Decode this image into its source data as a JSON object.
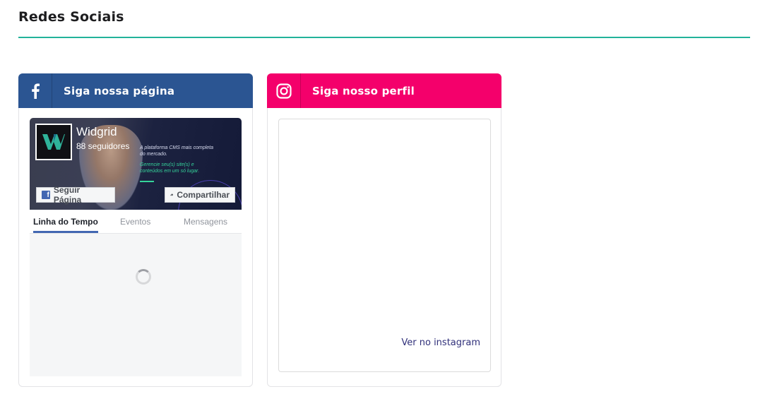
{
  "section": {
    "title": "Redes Sociais"
  },
  "facebook_card": {
    "header_label": "Siga nossa página",
    "icon": "facebook-icon",
    "color": "#2b5592",
    "embed": {
      "page_name": "Widgrid",
      "followers": "88 seguidores",
      "cover_text_primary": "A plataforma CMS mais completa do mercado.",
      "cover_text_secondary": "Gerencie seu(s) site(s) e conteúdos em um só lugar.",
      "follow_button": "Seguir Página",
      "share_button": "Compartilhar",
      "tabs": [
        {
          "label": "Linha do Tempo",
          "active": true
        },
        {
          "label": "Eventos",
          "active": false
        },
        {
          "label": "Mensagens",
          "active": false
        }
      ]
    }
  },
  "instagram_card": {
    "header_label": "Siga nosso perfil",
    "icon": "instagram-icon",
    "color": "#f4006b",
    "embed": {
      "link_text": "Ver no instagram"
    }
  }
}
